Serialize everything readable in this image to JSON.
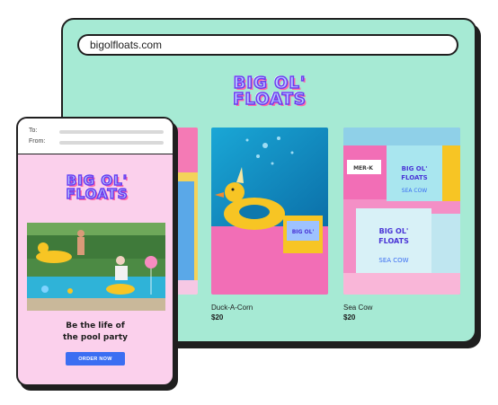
{
  "browser": {
    "url": "bigolfloats.com",
    "logo": {
      "line1": "BIG OL'",
      "line2": "FLOATS"
    }
  },
  "products": [
    {
      "name": "Duck-A-Corn",
      "price": "$20",
      "image": "duck-float-photo"
    },
    {
      "name": "Sea Cow",
      "price": "$20",
      "image": "sea-cow-boxes-photo",
      "box_labels": [
        "BIG OL' FLOATS",
        "SEA COW",
        "MER-K"
      ]
    }
  ],
  "email": {
    "to_label": "To:",
    "from_label": "From:",
    "logo": {
      "line1": "BIG OL'",
      "line2": "FLOATS"
    },
    "tagline_line1": "Be the life of",
    "tagline_line2": "the pool party",
    "cta_label": "ORDER NOW"
  },
  "colors": {
    "browser_bg": "#a6ead4",
    "email_bg": "#fbd0ec",
    "cta": "#3b6ef2",
    "logo_fill": "#b8c8ff",
    "logo_stroke": "#6a3df0",
    "logo_shadow": "#ff6aa7"
  }
}
